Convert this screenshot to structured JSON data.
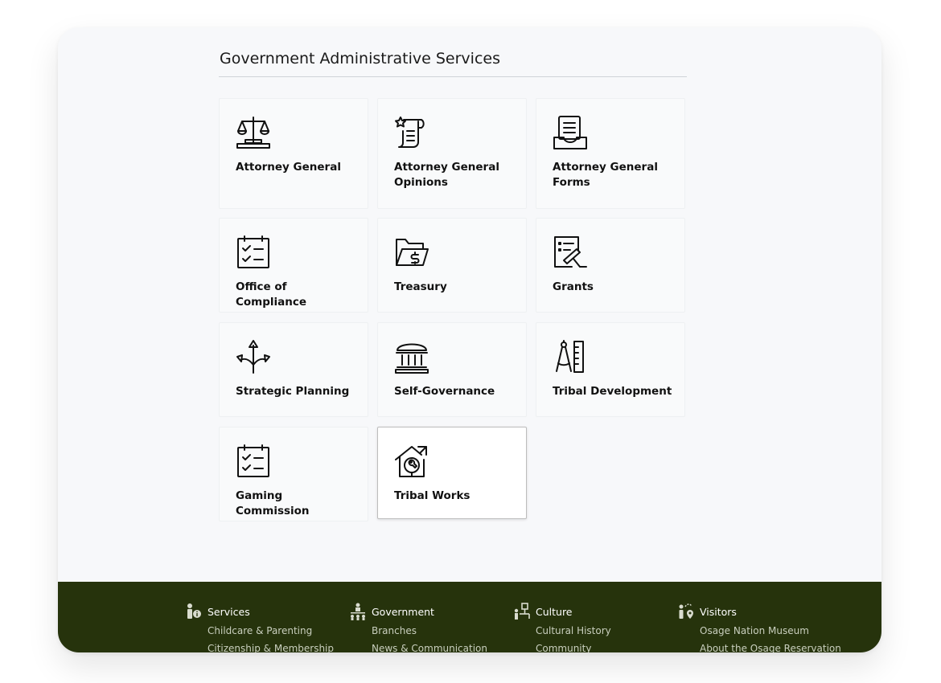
{
  "section": {
    "title": "Government Administrative Services"
  },
  "cards": [
    {
      "label": "Attorney General",
      "icon": "scales-icon"
    },
    {
      "label": "Attorney General Opinions",
      "icon": "scroll-star-icon"
    },
    {
      "label": "Attorney General Forms",
      "icon": "document-tray-icon"
    },
    {
      "label": "Office of Compliance",
      "icon": "checklist-calendar-icon"
    },
    {
      "label": "Treasury",
      "icon": "folder-dollar-icon"
    },
    {
      "label": "Grants",
      "icon": "document-sign-icon"
    },
    {
      "label": "Strategic Planning",
      "icon": "arrows-split-icon"
    },
    {
      "label": "Self-Governance",
      "icon": "government-building-icon"
    },
    {
      "label": "Tribal Development",
      "icon": "compass-ruler-icon"
    },
    {
      "label": "Gaming Commission",
      "icon": "checklist-calendar-icon"
    },
    {
      "label": "Tribal Works",
      "icon": "house-wrench-icon"
    }
  ],
  "footer": {
    "columns": [
      {
        "title": "Services",
        "icon": "person-info-icon",
        "links": [
          "Childcare & Parenting",
          "Citizenship & Membership"
        ]
      },
      {
        "title": "Government",
        "icon": "org-chart-icon",
        "links": [
          "Branches",
          "News & Communication"
        ]
      },
      {
        "title": "Culture",
        "icon": "people-tree-icon",
        "links": [
          "Cultural History",
          "Community"
        ]
      },
      {
        "title": "Visitors",
        "icon": "person-location-icon",
        "links": [
          "Osage Nation Museum",
          "About the Osage Reservation"
        ]
      }
    ]
  },
  "colors": {
    "footer_bg": "#26330c",
    "card_bg": "#f9fafb",
    "page_bg": "#f7f8fa"
  }
}
